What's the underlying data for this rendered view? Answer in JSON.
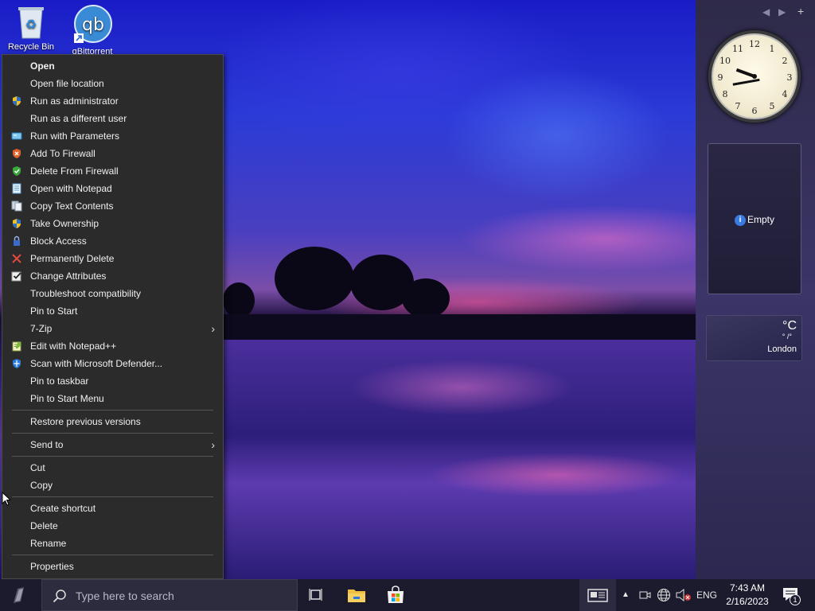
{
  "desktop": {
    "icons": [
      {
        "label": "Recycle Bin",
        "icon": "recycle-bin-icon"
      },
      {
        "label": "qBittorrent",
        "icon": "qbittorrent-icon"
      }
    ]
  },
  "context_menu": {
    "items": [
      {
        "label": "Open",
        "bold": true
      },
      {
        "label": "Open file location"
      },
      {
        "label": "Run as administrator",
        "icon": "uac-shield-icon"
      },
      {
        "label": "Run as a different user"
      },
      {
        "label": "Run with Parameters",
        "icon": "run-params-icon"
      },
      {
        "label": "Add To Firewall",
        "icon": "firewall-add-icon"
      },
      {
        "label": "Delete From Firewall",
        "icon": "firewall-delete-icon"
      },
      {
        "label": "Open with Notepad",
        "icon": "notepad-icon"
      },
      {
        "label": "Copy Text Contents",
        "icon": "copy-text-icon"
      },
      {
        "label": "Take Ownership",
        "icon": "ownership-shield-icon"
      },
      {
        "label": "Block Access",
        "icon": "block-lock-icon"
      },
      {
        "label": "Permanently Delete",
        "icon": "red-x-icon"
      },
      {
        "label": "Change Attributes",
        "icon": "attributes-check-icon"
      },
      {
        "label": "Troubleshoot compatibility"
      },
      {
        "label": "Pin to Start"
      },
      {
        "label": "7-Zip",
        "submenu": true
      },
      {
        "label": "Edit with Notepad++",
        "icon": "notepadpp-icon"
      },
      {
        "label": "Scan with Microsoft Defender...",
        "icon": "defender-icon"
      },
      {
        "label": "Pin to taskbar"
      },
      {
        "label": "Pin to Start Menu"
      },
      {
        "label": "Restore previous versions"
      },
      {
        "label": "Send to",
        "submenu": true
      },
      {
        "label": "Cut"
      },
      {
        "label": "Copy"
      },
      {
        "label": "Create shortcut"
      },
      {
        "label": "Delete"
      },
      {
        "label": "Rename"
      },
      {
        "label": "Properties"
      }
    ]
  },
  "sidebar": {
    "controls": [
      "◀",
      "▶",
      "+"
    ],
    "clock_numbers": [
      "12",
      "1",
      "2",
      "3",
      "4",
      "5",
      "6",
      "7",
      "8",
      "9",
      "10",
      "11"
    ],
    "widget_empty_label": "Empty",
    "weather": {
      "unit": "°C",
      "range": "° /°",
      "city": "London"
    }
  },
  "taskbar": {
    "search_placeholder": "Type here to search",
    "language": "ENG",
    "time": "7:43 AM",
    "date": "2/16/2023",
    "notifications_count": "1"
  },
  "colors": {
    "menu_bg": "#2b2b2b",
    "taskbar_bg": "#1c1b2e",
    "accent": "#3a7be0"
  }
}
